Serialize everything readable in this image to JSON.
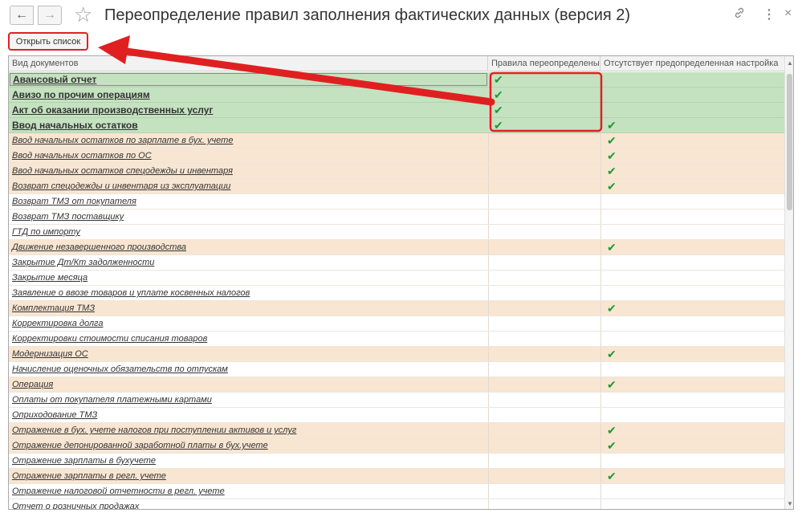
{
  "window": {
    "title": "Переопределение правил заполнения фактических данных (версия 2)",
    "back_icon": "←",
    "forward_icon": "→",
    "star_icon": "☆",
    "link_icon": "🔗",
    "more_icon": "⋮",
    "close_icon": "×"
  },
  "toolbar": {
    "open_list_label": "Открыть список"
  },
  "table": {
    "columns": [
      "Вид документов",
      "Правила переопределены",
      "Отсутствует предопределенная настройка"
    ],
    "rows": [
      {
        "name": "Авансовый отчет",
        "overridden": true,
        "no_default": false,
        "style": "bold",
        "selected": true
      },
      {
        "name": "Авизо по прочим операциям",
        "overridden": true,
        "no_default": false,
        "style": "bold"
      },
      {
        "name": "Акт об оказании производственных услуг",
        "overridden": true,
        "no_default": false,
        "style": "bold"
      },
      {
        "name": "Ввод начальных остатков",
        "overridden": true,
        "no_default": true,
        "style": "bold"
      },
      {
        "name": "Ввод начальных остатков по зарплате в бух. учете",
        "overridden": false,
        "no_default": true,
        "style": "orange"
      },
      {
        "name": "Ввод начальных остатков по ОС",
        "overridden": false,
        "no_default": true,
        "style": "orange"
      },
      {
        "name": "Ввод начальных остатков спецодежды и инвентаря",
        "overridden": false,
        "no_default": true,
        "style": "orange"
      },
      {
        "name": "Возврат спецодежды и инвентаря из эксплуатации",
        "overridden": false,
        "no_default": true,
        "style": "orange"
      },
      {
        "name": "Возврат ТМЗ от покупателя",
        "overridden": false,
        "no_default": false,
        "style": "white"
      },
      {
        "name": "Возврат ТМЗ поставщику",
        "overridden": false,
        "no_default": false,
        "style": "white"
      },
      {
        "name": "ГТД по импорту",
        "overridden": false,
        "no_default": false,
        "style": "white"
      },
      {
        "name": "Движение незавершенного производства",
        "overridden": false,
        "no_default": true,
        "style": "orange"
      },
      {
        "name": "Закрытие Дт/Кт задолженности",
        "overridden": false,
        "no_default": false,
        "style": "white"
      },
      {
        "name": "Закрытие месяца",
        "overridden": false,
        "no_default": false,
        "style": "white"
      },
      {
        "name": "Заявление о ввозе товаров и уплате косвенных налогов",
        "overridden": false,
        "no_default": false,
        "style": "white"
      },
      {
        "name": "Комплектация ТМЗ",
        "overridden": false,
        "no_default": true,
        "style": "orange"
      },
      {
        "name": "Корректировка долга",
        "overridden": false,
        "no_default": false,
        "style": "white"
      },
      {
        "name": "Корректировки стоимости списания товаров",
        "overridden": false,
        "no_default": false,
        "style": "white"
      },
      {
        "name": "Модернизация ОС",
        "overridden": false,
        "no_default": true,
        "style": "orange"
      },
      {
        "name": "Начисление оценочных обязательств по отпускам",
        "overridden": false,
        "no_default": false,
        "style": "white"
      },
      {
        "name": "Операция",
        "overridden": false,
        "no_default": true,
        "style": "orange"
      },
      {
        "name": "Оплаты от покупателя платежными картами",
        "overridden": false,
        "no_default": false,
        "style": "white"
      },
      {
        "name": "Оприходование ТМЗ",
        "overridden": false,
        "no_default": false,
        "style": "white"
      },
      {
        "name": "Отражение в бух. учете налогов при поступлении активов и услуг",
        "overridden": false,
        "no_default": true,
        "style": "orange"
      },
      {
        "name": "Отражение депонированной заработной платы в бух.учете",
        "overridden": false,
        "no_default": true,
        "style": "orange"
      },
      {
        "name": "Отражение зарплаты в бухучете",
        "overridden": false,
        "no_default": false,
        "style": "white"
      },
      {
        "name": "Отражение зарплаты в регл. учете",
        "overridden": false,
        "no_default": true,
        "style": "orange"
      },
      {
        "name": "Отражение налоговой отчетности в регл. учете",
        "overridden": false,
        "no_default": false,
        "style": "white"
      },
      {
        "name": "Отчет о розничных продажах",
        "overridden": false,
        "no_default": false,
        "style": "white"
      }
    ]
  },
  "check_glyph": "✔",
  "colors": {
    "highlight_red": "#e02020",
    "row_overridden": "#c4e2c0",
    "row_no_default": "#f8e6d2",
    "check_green": "#1b9a35"
  }
}
